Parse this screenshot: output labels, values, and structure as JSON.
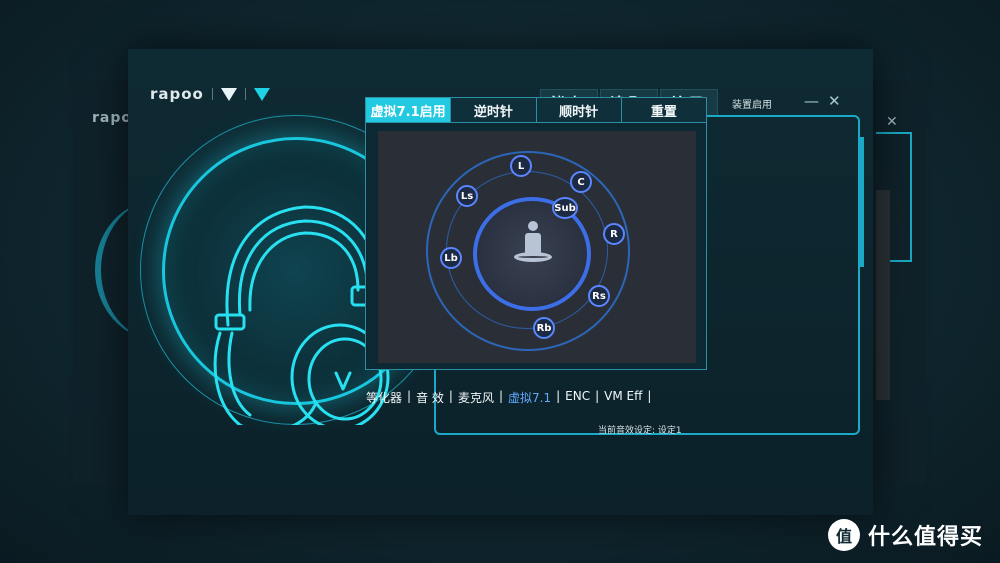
{
  "app": {
    "logo_text": "rapoo",
    "ghost_logo": "rapoo"
  },
  "toolbar": {
    "save_label": "储存",
    "load_label": "读取",
    "about_label": "关于",
    "device_label": "装置启用",
    "minimize_glyph": "—",
    "close_glyph": "✕"
  },
  "surround": {
    "tabs": [
      "虚拟7.1启用",
      "逆时针",
      "顺时针",
      "重置"
    ],
    "active_tab_index": 0,
    "speakers": {
      "L": "L",
      "C": "C",
      "Sub": "Sub",
      "R": "R",
      "Rs": "Rs",
      "Rb": "Rb",
      "Lb": "Lb",
      "Ls": "Ls"
    }
  },
  "bottom_tabs": [
    {
      "label": "等化器",
      "active": false
    },
    {
      "label": "音  效",
      "active": false
    },
    {
      "label": "麦克风",
      "active": false
    },
    {
      "label": "虚拟7.1",
      "active": true
    },
    {
      "label": "ENC",
      "active": false
    },
    {
      "label": "VM Eff",
      "active": false
    }
  ],
  "status": {
    "current_effect": "当前音效设定: 设定1"
  },
  "watermark": {
    "icon_glyph": "值",
    "text": "什么值得买"
  },
  "colors": {
    "accent_cyan": "#22c9e1",
    "accent_blue": "#3c6ee8",
    "background": "#0c2129"
  }
}
